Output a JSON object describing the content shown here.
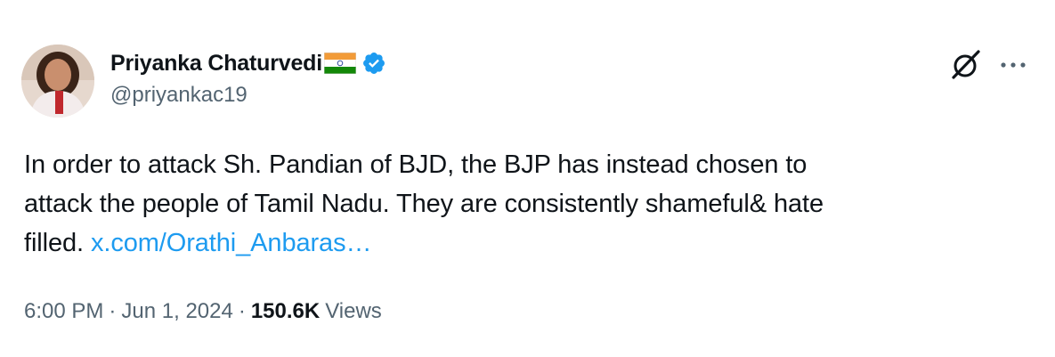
{
  "author": {
    "display_name": "Priyanka Chaturvedi",
    "flag_emoji_icon": "india-flag-icon",
    "verified_icon": "verified-badge-icon",
    "handle": "@priyankac19"
  },
  "actions": {
    "grok_icon": "grok-icon",
    "more_icon": "more-icon"
  },
  "tweet": {
    "line1": "In order to attack Sh. Pandian of BJD, the BJP has instead chosen to",
    "line2": "attack the people of Tamil Nadu. They are consistently shameful& hate",
    "line3": "filled.",
    "link_text": "x.com/Orathi_Anbaras…"
  },
  "meta": {
    "time": "6:00 PM",
    "separator": "·",
    "date": "Jun 1, 2024",
    "views_count": "150.6K",
    "views_label": "Views"
  },
  "colors": {
    "link": "#1d9bf0",
    "secondary_text": "#536471",
    "primary_text": "#0f1419",
    "verified": "#1d9bf0"
  }
}
